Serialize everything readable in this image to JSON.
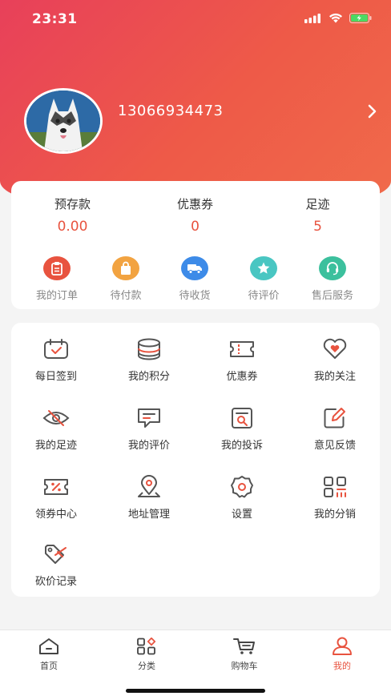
{
  "status_bar": {
    "time": "23:31"
  },
  "profile": {
    "phone": "13066934473"
  },
  "stats": [
    {
      "label": "预存款",
      "value": "0.00"
    },
    {
      "label": "优惠券",
      "value": "0"
    },
    {
      "label": "足迹",
      "value": "5"
    }
  ],
  "orders": [
    {
      "label": "我的订单",
      "icon": "clipboard-icon",
      "color": "#e8533f"
    },
    {
      "label": "待付款",
      "icon": "bag-icon",
      "color": "#f2a341"
    },
    {
      "label": "待收货",
      "icon": "truck-icon",
      "color": "#3d8be8"
    },
    {
      "label": "待评价",
      "icon": "star-icon",
      "color": "#49c6c2"
    },
    {
      "label": "售后服务",
      "icon": "headset-icon",
      "color": "#3cc09d"
    }
  ],
  "services": [
    {
      "label": "每日签到",
      "icon": "calendar-check-icon"
    },
    {
      "label": "我的积分",
      "icon": "coins-icon"
    },
    {
      "label": "优惠券",
      "icon": "coupon-icon"
    },
    {
      "label": "我的关注",
      "icon": "heart-icon"
    },
    {
      "label": "我的足迹",
      "icon": "eye-off-icon"
    },
    {
      "label": "我的评价",
      "icon": "comment-icon"
    },
    {
      "label": "我的投诉",
      "icon": "complaint-icon"
    },
    {
      "label": "意见反馈",
      "icon": "edit-icon"
    },
    {
      "label": "领券中心",
      "icon": "ticket-icon"
    },
    {
      "label": "地址管理",
      "icon": "location-icon"
    },
    {
      "label": "设置",
      "icon": "settings-icon"
    },
    {
      "label": "我的分销",
      "icon": "distribution-icon"
    },
    {
      "label": "砍价记录",
      "icon": "bargain-tag-icon"
    }
  ],
  "tabbar": [
    {
      "label": "首页",
      "icon": "home-icon",
      "active": false
    },
    {
      "label": "分类",
      "icon": "category-icon",
      "active": false
    },
    {
      "label": "购物车",
      "icon": "cart-icon",
      "active": false
    },
    {
      "label": "我的",
      "icon": "user-icon",
      "active": true
    }
  ],
  "colors": {
    "accent": "#e8533f",
    "header_start": "#e8405a",
    "header_end": "#f06a4a"
  }
}
